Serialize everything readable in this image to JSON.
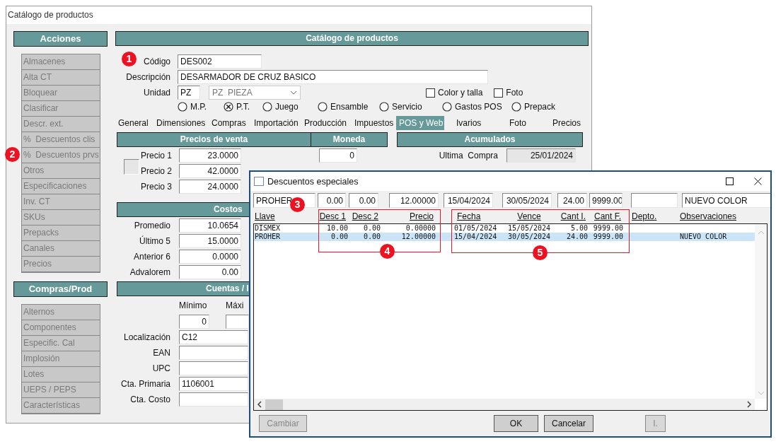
{
  "main_window": {
    "title": "Catálogo de productos"
  },
  "sidebar": {
    "sections": [
      {
        "title": "Acciones",
        "items": [
          {
            "label": "Almacenes"
          },
          {
            "label": "Alta CT"
          },
          {
            "label": "Bloquear"
          },
          {
            "label": "Clasificar"
          },
          {
            "label": "Descr. ext."
          },
          {
            "label": "%  Descuentos clis"
          },
          {
            "label": "%  Descuentos prvs"
          },
          {
            "label": "Otros"
          },
          {
            "label": "Especificaciones"
          },
          {
            "label": "Inv. CT"
          },
          {
            "label": "SKUs"
          },
          {
            "label": "Prepacks"
          },
          {
            "label": "Canales"
          },
          {
            "label": "Precios"
          }
        ]
      },
      {
        "title": "Compras/Prod",
        "items": [
          {
            "label": "Alternos"
          },
          {
            "label": "Componentes"
          },
          {
            "label": "Especific. Cal"
          },
          {
            "label": "Implosión"
          },
          {
            "label": "Lotes"
          },
          {
            "label": "UEPS / PEPS"
          },
          {
            "label": "Características"
          }
        ]
      }
    ]
  },
  "header": "Catálogo de productos",
  "form": {
    "codigo": {
      "label": "Código",
      "value": "DES002"
    },
    "descripcion": {
      "label": "Descripción",
      "value": "DESARMADOR DE CRUZ BASICO"
    },
    "unidad": {
      "label": "Unidad",
      "value": "PZ",
      "combo": "PZ  PIEZA"
    },
    "checkboxes": [
      {
        "label": "Color y talla",
        "checked": false
      },
      {
        "label": "Foto",
        "checked": false
      }
    ],
    "radios": [
      {
        "label": "M.P.",
        "selected": false
      },
      {
        "label": "P.T.",
        "selected": true
      },
      {
        "label": "Juego",
        "selected": false
      },
      {
        "label": "Ensamble",
        "selected": false
      },
      {
        "label": "Servicio",
        "selected": false
      },
      {
        "label": "Gastos POS",
        "selected": false
      },
      {
        "label": "Prepack",
        "selected": false
      }
    ]
  },
  "tabs": [
    {
      "label": "General",
      "selected": false
    },
    {
      "label": "Dimensiones",
      "selected": false
    },
    {
      "label": "Compras",
      "selected": false
    },
    {
      "label": "Importación",
      "selected": false
    },
    {
      "label": "Producción",
      "selected": false
    },
    {
      "label": "Impuestos",
      "selected": false
    },
    {
      "label": "POS y Web",
      "selected": true
    },
    {
      "label": "Ivarios",
      "selected": false
    },
    {
      "label": "Foto",
      "selected": false
    },
    {
      "label": "Precios",
      "selected": false
    }
  ],
  "precios_venta": {
    "title": "Precios de venta",
    "rows": [
      {
        "label": "Precio 1",
        "value": "23.0000"
      },
      {
        "label": "Precio 2",
        "value": "42.0000"
      },
      {
        "label": "Precio 3",
        "value": "24.0000"
      }
    ]
  },
  "moneda": {
    "title": "Moneda",
    "values": [
      "0"
    ]
  },
  "acumulados": {
    "title": "Acumulados",
    "rows": [
      {
        "label": "Ultima  Compra",
        "value": "25/01/2024"
      }
    ]
  },
  "costos": {
    "title": "Costos",
    "rows": [
      {
        "label": "Promedio",
        "value": "10.0654"
      },
      {
        "label": "Último 5",
        "value": "15.0000"
      },
      {
        "label": "Anterior 6",
        "value": "0.0000"
      },
      {
        "label": "Advalorem",
        "value": "0.00"
      }
    ]
  },
  "cuentas": {
    "title": "Cuentas / I",
    "limits": [
      {
        "label": "Mínimo",
        "value": "0"
      },
      {
        "label": "Máxi"
      }
    ],
    "rows": [
      {
        "label": "Localización",
        "value": "C12"
      },
      {
        "label": "EAN"
      },
      {
        "label": "UPC"
      },
      {
        "label": "Cta. Primaria",
        "value": "1106001"
      },
      {
        "label": "Cta. Costo"
      }
    ]
  },
  "dialog": {
    "title": "Descuentos especiales",
    "edit_fields": [
      {
        "value": "PROHER",
        "kind": "text"
      },
      {
        "value": "0.00",
        "kind": "number"
      },
      {
        "value": "0.00",
        "kind": "number"
      },
      {
        "value": "12.00000",
        "kind": "number"
      },
      {
        "value": "15/04/2024",
        "kind": "number"
      },
      {
        "value": "30/05/2024",
        "kind": "number"
      },
      {
        "value": "24.00",
        "kind": "number"
      },
      {
        "value": "9999.00",
        "kind": "number"
      },
      {
        "kind": "text"
      },
      {
        "value": "NUEVO COLOR",
        "kind": "text"
      }
    ],
    "columns": [
      "Llave",
      "Desc 1",
      "Desc 2",
      "Precio",
      "Fecha",
      "Vence",
      "Cant I.",
      "Cant F.",
      "Depto.",
      "Observaciones"
    ],
    "rows": [
      {
        "cells": [
          "DISMEX",
          "10.00",
          "0.00",
          "0.00000",
          "01/05/2024",
          "15/05/2024",
          "5.00",
          "9999.00"
        ],
        "selected": false
      },
      {
        "cells": [
          "PROHER",
          "0.00",
          "0.00",
          "12.00000",
          "15/04/2024",
          "30/05/2024",
          "24.00",
          "9999.00",
          "",
          "NUEVO COLOR"
        ],
        "selected": true
      }
    ],
    "buttons": [
      {
        "label": "Cambiar",
        "disabled": true
      },
      {
        "label": "OK",
        "disabled": false
      },
      {
        "label": "Cancelar",
        "disabled": false
      },
      {
        "label": "I.",
        "disabled": true
      }
    ]
  },
  "annotations": [
    {
      "number": "1"
    },
    {
      "number": "2"
    },
    {
      "number": "3"
    },
    {
      "number": "4"
    },
    {
      "number": "5"
    }
  ]
}
